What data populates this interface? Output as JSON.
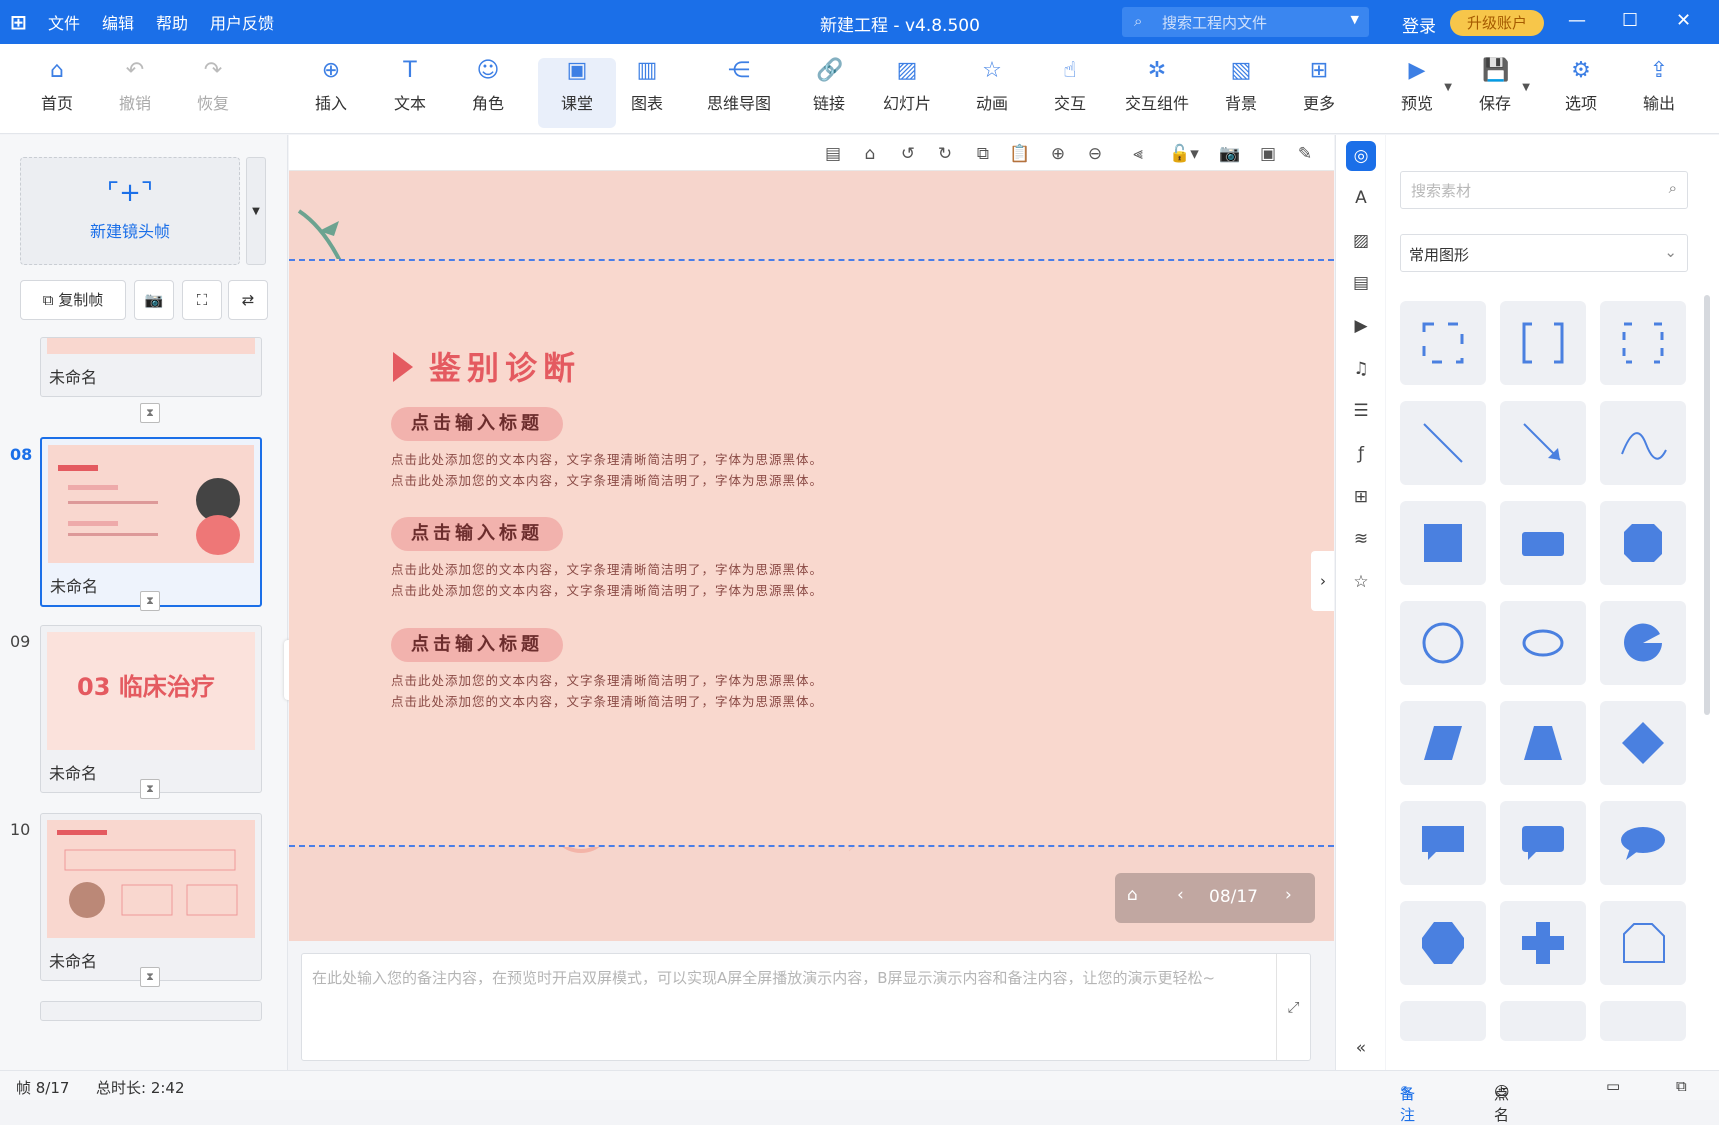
{
  "window": {
    "title": "新建工程 - v4.8.500",
    "search_placeholder": "搜索工程内文件",
    "login": "登录",
    "upgrade": "升级账户"
  },
  "menu": [
    "文件",
    "编辑",
    "帮助",
    "用户反馈"
  ],
  "toolbar": {
    "home": "首页",
    "undo": "撤销",
    "redo": "恢复",
    "insert": "插入",
    "text": "文本",
    "role": "角色",
    "classroom": "课堂",
    "chart": "图表",
    "mindmap": "思维导图",
    "link": "链接",
    "slideshow": "幻灯片",
    "animation": "动画",
    "interact": "交互",
    "interact_widget": "交互组件",
    "background": "背景",
    "more": "更多",
    "preview": "预览",
    "save": "保存",
    "options": "选项",
    "export": "输出"
  },
  "left": {
    "new_frame": "新建镜头帧",
    "copy_frame": "复制帧",
    "slides": [
      {
        "num": "",
        "name": "未命名"
      },
      {
        "num": "08",
        "name": "未命名"
      },
      {
        "num": "09",
        "name": "未命名"
      },
      {
        "num": "10",
        "name": "未命名"
      }
    ],
    "thumb9_title": "03 临床治疗"
  },
  "slide": {
    "heading": "鉴别诊断",
    "sections": [
      {
        "title": "点击输入标题",
        "line1": "点击此处添加您的文本内容，文字条理清晰简洁明了，字体为思源黑体。",
        "line2": "点击此处添加您的文本内容，文字条理清晰简洁明了，字体为思源黑体。"
      },
      {
        "title": "点击输入标题",
        "line1": "点击此处添加您的文本内容，文字条理清晰简洁明了，字体为思源黑体。",
        "line2": "点击此处添加您的文本内容，文字条理清晰简洁明了，字体为思源黑体。"
      },
      {
        "title": "点击输入标题",
        "line1": "点击此处添加您的文本内容，文字条理清晰简洁明了，字体为思源黑体。",
        "line2": "点击此处添加您的文本内容，文字条理清晰简洁明了，字体为思源黑体。"
      }
    ],
    "page_indicator": "08/17"
  },
  "notes": {
    "placeholder": "在此处输入您的备注内容，在预览时开启双屏模式，可以实现A屏全屏播放演示内容，B屏显示演示内容和备注内容，让您的演示更轻松~"
  },
  "right": {
    "search_placeholder": "搜索素材",
    "category": "常用图形"
  },
  "status": {
    "frame": "帧 8/17",
    "duration": "总时长: 2:42",
    "notes": "备注",
    "rollcall": "点名"
  }
}
